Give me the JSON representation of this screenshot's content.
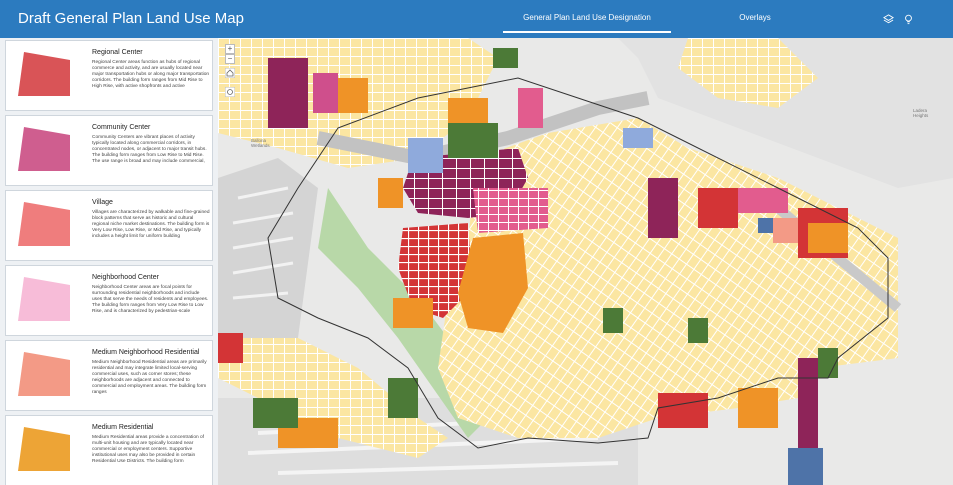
{
  "header": {
    "title": "Draft General Plan Land Use Map",
    "tabs": [
      {
        "label": "General Plan Land Use Designation",
        "active": true
      },
      {
        "label": "Overlays",
        "active": false
      }
    ],
    "icons": [
      "layers-icon",
      "lightbulb-icon"
    ],
    "background_color": "#2c7bbf"
  },
  "legend": [
    {
      "title": "Regional Center",
      "color": "#d95457",
      "description": "Regional Center areas function as hubs of regional commerce and activity, and are usually located near major transportation hubs or along major transportation corridors. The building form ranges from Mid Rise to High Rise, with active shopfronts and active"
    },
    {
      "title": "Community Center",
      "color": "#cf5e8f",
      "description": "Community Centers are vibrant places of activity typically located along commercial corridors, in concentrated nodes, or adjacent to major transit hubs. The building form ranges from Low Rise to Mid Rise. The use range is broad and may include commercial,"
    },
    {
      "title": "Village",
      "color": "#ef7d7d",
      "description": "Villages are characterized by walkable and fine-grained block patterns that serve as historic and cultural regional niche market destinations. The building form is Very Low Rise, Low Rise, or Mid Rise, and typically includes a height limit for uniform building"
    },
    {
      "title": "Neighborhood Center",
      "color": "#f7bcd8",
      "description": "Neighborhood Center areas are focal points for surrounding residential neighborhoods and include uses that serve the needs of residents and employees. The building form ranges from Very Low Rise to Low Rise, and is characterized by pedestrian-scale"
    },
    {
      "title": "Medium Neighborhood Residential",
      "color": "#f39a86",
      "description": "Medium Neighborhood Residential areas are primarily residential and may integrate limited local-serving commercial uses, such as corner stores; these neighborhoods are adjacent and connected to commercial and employment areas. The building form ranges"
    },
    {
      "title": "Medium Residential",
      "color": "#eda436",
      "description": "Medium Residential areas provide a concentration of multi-unit housing and are typically located near commercial or employment centers. Supportive institutional uses may also be provided in certain Residential Use Districts. The building form"
    }
  ],
  "map": {
    "zoom_in": "+",
    "zoom_out": "−",
    "labels": [
      {
        "text": "Ladera Heights"
      },
      {
        "text": "Ballona Wetlands"
      }
    ],
    "colors": {
      "base": "#e9e9e8",
      "low_residential": "#fbe6a2",
      "regional_center": "#d33436",
      "community_center": "#8e2459",
      "neighborhood_center": "#f4b6d0",
      "medium_residential": "#ef9327",
      "open_space": "#4c7a37",
      "public_facilities": "#8faadc",
      "industrial": "#4e73a8",
      "parks": "#b8d8a8",
      "freeway": "#c9c9c9"
    }
  }
}
